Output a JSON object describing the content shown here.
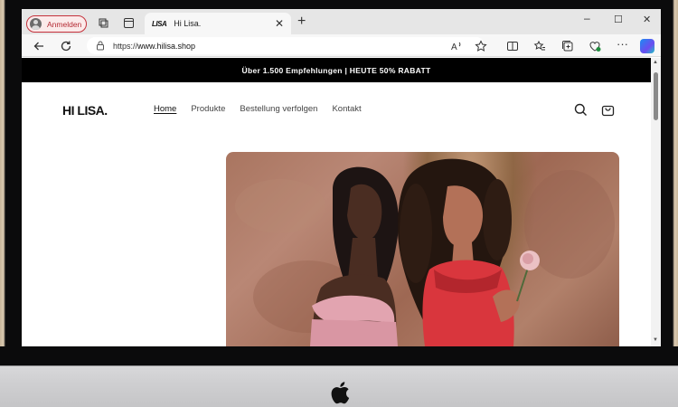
{
  "browser": {
    "profile_label": "Anmelden",
    "tab": {
      "favicon_text": "LISA",
      "title": "Hi Lisa."
    },
    "address": {
      "scheme": "https://",
      "host": "www.hilisa.shop"
    },
    "controls": {
      "minimize": "–",
      "maximize": "☐",
      "close": "✕",
      "new_tab": "+",
      "more": "···"
    }
  },
  "site": {
    "announcement": "Über 1.500 Empfehlungen | HEUTE 50% RABATT",
    "logo": "HI LISA.",
    "nav": [
      {
        "label": "Home",
        "active": true
      },
      {
        "label": "Produkte",
        "active": false
      },
      {
        "label": "Bestellung verfolgen",
        "active": false
      },
      {
        "label": "Kontakt",
        "active": false
      }
    ]
  },
  "colors": {
    "profile_accent": "#c4313b",
    "announcement_bg": "#000000",
    "hero_wall": "#a97560"
  }
}
